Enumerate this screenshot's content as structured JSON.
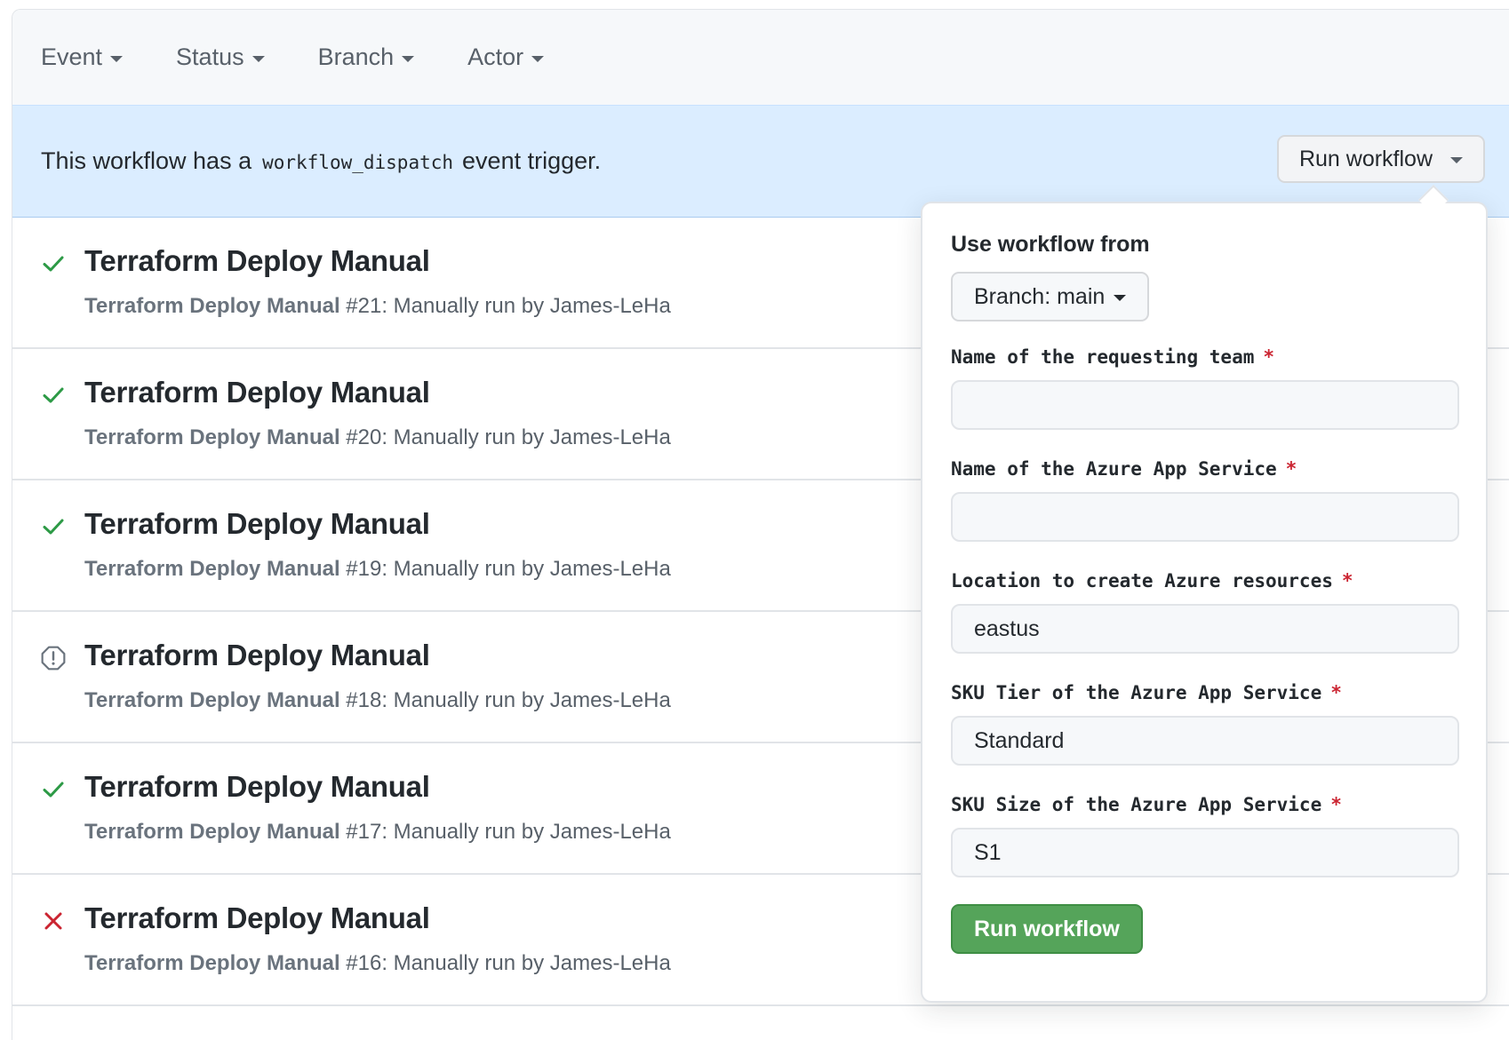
{
  "filters": [
    {
      "label": "Event"
    },
    {
      "label": "Status"
    },
    {
      "label": "Branch"
    },
    {
      "label": "Actor"
    }
  ],
  "banner": {
    "text_before": "This workflow has a",
    "code": "workflow_dispatch",
    "text_after": "event trigger.",
    "run_button_label": "Run workflow"
  },
  "runs": [
    {
      "status": "success",
      "title": "Terraform Deploy Manual",
      "workflow": "Terraform Deploy Manual",
      "detail": "#21: Manually run by James-LeHa"
    },
    {
      "status": "success",
      "title": "Terraform Deploy Manual",
      "workflow": "Terraform Deploy Manual",
      "detail": "#20: Manually run by James-LeHa"
    },
    {
      "status": "success",
      "title": "Terraform Deploy Manual",
      "workflow": "Terraform Deploy Manual",
      "detail": "#19: Manually run by James-LeHa"
    },
    {
      "status": "cancelled",
      "title": "Terraform Deploy Manual",
      "workflow": "Terraform Deploy Manual",
      "detail": "#18: Manually run by James-LeHa"
    },
    {
      "status": "success",
      "title": "Terraform Deploy Manual",
      "workflow": "Terraform Deploy Manual",
      "detail": "#17: Manually run by James-LeHa"
    },
    {
      "status": "failure",
      "title": "Terraform Deploy Manual",
      "workflow": "Terraform Deploy Manual",
      "detail": "#16: Manually run by James-LeHa"
    }
  ],
  "status_colors": {
    "success": "#28a745",
    "failure": "#cb2431",
    "cancelled": "#6a737d"
  },
  "popover": {
    "heading": "Use workflow from",
    "branch_button": "Branch: main",
    "fields": [
      {
        "label": "Name of the requesting team",
        "required": "*",
        "value": ""
      },
      {
        "label": "Name of the Azure App Service",
        "required": "*",
        "value": ""
      },
      {
        "label": "Location to create Azure resources",
        "required": "*",
        "value": "eastus"
      },
      {
        "label": "SKU Tier of the Azure App Service",
        "required": "*",
        "value": "Standard"
      },
      {
        "label": "SKU Size of the Azure App Service",
        "required": "*",
        "value": "S1"
      }
    ],
    "submit_label": "Run workflow"
  }
}
